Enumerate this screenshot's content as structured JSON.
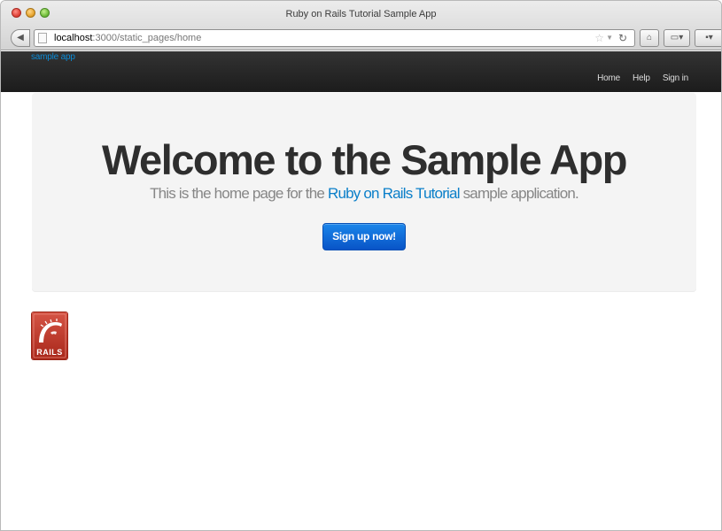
{
  "browser": {
    "window_title": "Ruby on Rails Tutorial Sample App",
    "url_host": "localhost",
    "url_path": ":3000/static_pages/home"
  },
  "navbar": {
    "brand": "sample app",
    "links": [
      "Home",
      "Help",
      "Sign in"
    ]
  },
  "hero": {
    "title": "Welcome to the Sample App",
    "subtitle_before": "This is the home page for the ",
    "subtitle_link": "Ruby on Rails Tutorial",
    "subtitle_after": " sample application.",
    "button_label": "Sign up now!"
  },
  "footer_logo": {
    "text": "RAILS"
  },
  "colors": {
    "navbar_bg": "#1c1c1c",
    "brand": "#0b8bd6",
    "link": "#0b7fc9",
    "button": "#0854c7",
    "jumbotron_bg": "#f4f4f4"
  }
}
